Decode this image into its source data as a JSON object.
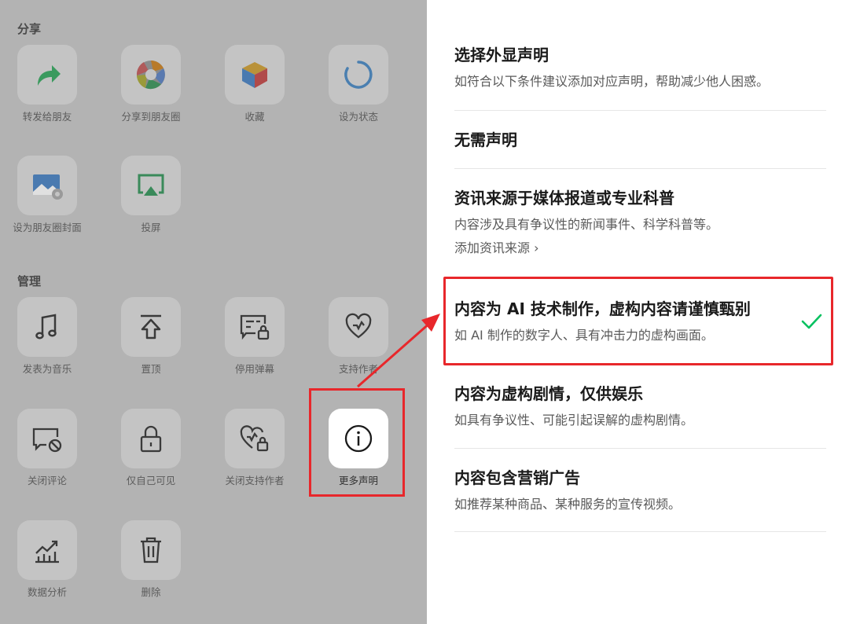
{
  "left": {
    "share_section": "分享",
    "manage_section": "管理",
    "share_items": [
      {
        "label": "转发给朋友",
        "icon": "forward-arrow-icon"
      },
      {
        "label": "分享到朋友圈",
        "icon": "moments-aperture-icon"
      },
      {
        "label": "收藏",
        "icon": "favorite-cube-icon"
      },
      {
        "label": "设为状态",
        "icon": "status-ring-icon"
      },
      {
        "label": "设为朋友圈封面",
        "icon": "cover-image-icon"
      },
      {
        "label": "投屏",
        "icon": "cast-screen-icon"
      }
    ],
    "manage_items": [
      {
        "label": "发表为音乐",
        "icon": "music-note-icon"
      },
      {
        "label": "置顶",
        "icon": "pin-top-icon"
      },
      {
        "label": "停用弹幕",
        "icon": "danmaku-lock-icon"
      },
      {
        "label": "支持作者",
        "icon": "heart-support-icon"
      },
      {
        "label": "关闭评论",
        "icon": "comment-off-icon"
      },
      {
        "label": "仅自己可见",
        "icon": "private-lock-icon"
      },
      {
        "label": "关闭支持作者",
        "icon": "support-lock-icon"
      },
      {
        "label": "更多声明",
        "icon": "info-circle-icon"
      },
      {
        "label": "数据分析",
        "icon": "analytics-chart-icon"
      },
      {
        "label": "删除",
        "icon": "trash-icon"
      }
    ]
  },
  "right": {
    "header": {
      "title": "选择外显声明",
      "desc": "如符合以下条件建议添加对应声明，帮助减少他人困惑。"
    },
    "options": [
      {
        "title": "无需声明",
        "desc": ""
      },
      {
        "title": "资讯来源于媒体报道或专业科普",
        "desc": "内容涉及具有争议性的新闻事件、科学科普等。",
        "link": "添加资讯来源"
      },
      {
        "title": "内容为 AI 技术制作，虚构内容请谨慎甄别",
        "desc": "如 AI 制作的数字人、具有冲击力的虚构画面。",
        "selected": true
      },
      {
        "title": "内容为虚构剧情，仅供娱乐",
        "desc": "如具有争议性、可能引起误解的虚构剧情。"
      },
      {
        "title": "内容包含营销广告",
        "desc": "如推荐某种商品、某种服务的宣传视频。"
      }
    ]
  },
  "colors": {
    "highlight": "#e8272b",
    "check": "#07c160",
    "dim_overlay": "#b3b3b3"
  }
}
